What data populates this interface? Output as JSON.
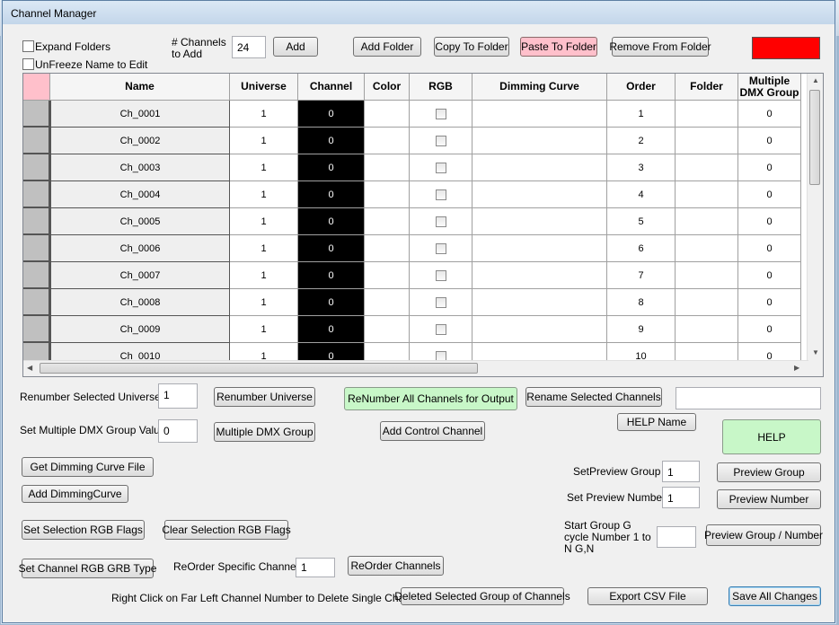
{
  "window": {
    "title": "Channel Manager"
  },
  "toolbar": {
    "expand_folders": "Expand Folders",
    "unfreeze_name": "UnFreeze Name to Edit",
    "channels_to_add_label": "# Channels to Add",
    "channels_to_add_value": "24",
    "add": "Add",
    "add_folder": "Add Folder",
    "copy_to_folder": "Copy To Folder",
    "paste_to_folder": "Paste To Folder",
    "remove_from_folder": "Remove From Folder",
    "status_color": "#ff0000"
  },
  "grid": {
    "columns": [
      "",
      "Name",
      "Universe",
      "Channel",
      "Color",
      "RGB",
      "Dimming Curve",
      "Order",
      "Folder",
      "Multiple DMX Group"
    ],
    "rows": [
      {
        "name": "Ch_0001",
        "universe": "1",
        "channel": "0",
        "order": "1",
        "dmx": "0"
      },
      {
        "name": "Ch_0002",
        "universe": "1",
        "channel": "0",
        "order": "2",
        "dmx": "0"
      },
      {
        "name": "Ch_0003",
        "universe": "1",
        "channel": "0",
        "order": "3",
        "dmx": "0"
      },
      {
        "name": "Ch_0004",
        "universe": "1",
        "channel": "0",
        "order": "4",
        "dmx": "0"
      },
      {
        "name": "Ch_0005",
        "universe": "1",
        "channel": "0",
        "order": "5",
        "dmx": "0"
      },
      {
        "name": "Ch_0006",
        "universe": "1",
        "channel": "0",
        "order": "6",
        "dmx": "0"
      },
      {
        "name": "Ch_0007",
        "universe": "1",
        "channel": "0",
        "order": "7",
        "dmx": "0"
      },
      {
        "name": "Ch_0008",
        "universe": "1",
        "channel": "0",
        "order": "8",
        "dmx": "0"
      },
      {
        "name": "Ch_0009",
        "universe": "1",
        "channel": "0",
        "order": "9",
        "dmx": "0"
      },
      {
        "name": "Ch_0010",
        "universe": "1",
        "channel": "0",
        "order": "10",
        "dmx": "0"
      }
    ]
  },
  "controls": {
    "renumber_selected_universe_label": "Renumber Selected Universe",
    "renumber_selected_universe_value": "1",
    "renumber_universe": "Renumber Universe",
    "renumber_all": "ReNumber All Channels for Output",
    "rename_selected": "Rename Selected Channels",
    "rename_value": "",
    "set_dmx_group_label": "Set Multiple DMX Group Value",
    "set_dmx_group_value": "0",
    "multiple_dmx_group": "Multiple DMX Group",
    "add_control_channel": "Add Control Channel",
    "help_name": "HELP Name",
    "help": "HELP",
    "get_dimming_curve_file": "Get Dimming Curve File",
    "add_dimming_curve": "Add DimmingCurve",
    "set_preview_group_label": "SetPreview Group",
    "set_preview_group_value": "1",
    "preview_group": "Preview Group",
    "set_preview_number_label": "Set Preview Number",
    "set_preview_number_value": "1",
    "preview_number": "Preview Number",
    "set_selection_rgb": "Set Selection RGB Flags",
    "clear_selection_rgb": "Clear Selection RGB Flags",
    "start_group_label": "Start Group G cycle Number 1 to N G,N",
    "start_group_value": "",
    "preview_group_number": "Preview Group / Number",
    "set_channel_rgb_grb": "Set Channel RGB GRB Type",
    "reorder_specific_label": "ReOrder Specific Channels",
    "reorder_specific_value": "1",
    "reorder_channels": "ReOrder Channels",
    "right_click_hint": "Right Click on Far Left Channel Number to Delete Single Channel",
    "delete_selected_group": "Deleted Selected Group of Channels",
    "export_csv": "Export CSV File",
    "save_all": "Save All Changes"
  }
}
